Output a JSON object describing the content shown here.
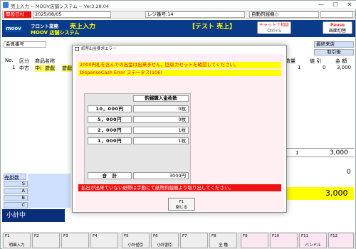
{
  "window": {
    "title": "売上入力 -- MOOV店舗システム -- Ver3.28.04",
    "min": "—",
    "max": "☐",
    "close": "✕"
  },
  "infobar": {
    "open_date_label": "開設日付",
    "open_date_value": "2025/08/05",
    "register_label": "レジ番号:14",
    "auto_drawer_label": "自動釣銭機○"
  },
  "header": {
    "logo": "moov",
    "front": "フロント業務",
    "shop": "MOOV 店舗システム",
    "screen": "売上入力",
    "mode": "【テスト 売上】",
    "chat_button_line1": "チャットで相談",
    "chat_button_line2": "Ctrl+S",
    "pause_line1": "Pause",
    "pause_line2": "画面切替"
  },
  "grid": {
    "member_label": "会員番号",
    "last_shop_label": "最終来店",
    "take_label": "取引後",
    "col_no": "No.",
    "col_kubun": "区分",
    "col_product": "商品名称",
    "col_qty": "数量",
    "col_discount": "値 引",
    "col_amount": "金 額",
    "row_no": "1",
    "row_kubun": "中古",
    "row_product": "中）遊戯",
    "row_product2": "遊戯",
    "row_qty": "1",
    "row_discount": "0",
    "row_amount": "3,000",
    "total_qty": "1",
    "total_amount": "3,000",
    "zero_value": "0",
    "grand_total": "3,000"
  },
  "side": {
    "title": "売掛数",
    "rows": [
      "S",
      "A",
      "B",
      "C"
    ],
    "subtotal": "小計中"
  },
  "dialog": {
    "title": "紙幣出金要求エラー",
    "message1": "2000円札を含んでの出金は出来ません。回収カセットを確認してください。",
    "message2": "DispenseCash Error ステータス(106)",
    "table_header": "釣銭職入金枚数",
    "rows": [
      {
        "label": "10，000円",
        "value": "0枚"
      },
      {
        "label": "5，000円",
        "value": "0枚"
      },
      {
        "label": "2，000円",
        "value": "1枚"
      },
      {
        "label": "1，000円",
        "value": "1枚"
      }
    ],
    "total_label": "合　計",
    "total_value": "3000円",
    "error_bar": "払出が出来ていない紙幣は手動にて紙幣釣銭機より取り出してください。",
    "close_key": "F1",
    "close_label": "閉じる"
  },
  "fkeys": [
    {
      "key": "F1",
      "label": "明細入力"
    },
    {
      "key": "F2",
      "label": ""
    },
    {
      "key": "F3",
      "label": ""
    },
    {
      "key": "F4",
      "label": ""
    },
    {
      "key": "F5",
      "label": "小計値引"
    },
    {
      "key": "F6",
      "label": "小計割引"
    },
    {
      "key": "F7",
      "label": ""
    },
    {
      "key": "F8",
      "label": "全 種"
    },
    {
      "key": "F9",
      "label": ""
    },
    {
      "key": "F10",
      "label": ""
    },
    {
      "key": "F11",
      "label": "バンドル"
    },
    {
      "key": "F12",
      "label": ""
    }
  ],
  "colors": {
    "header_bg": "#0a3a8a",
    "dialog_bg": "#ffeef2",
    "error_bg": "#ee1111",
    "highlight": "#ffff00"
  }
}
